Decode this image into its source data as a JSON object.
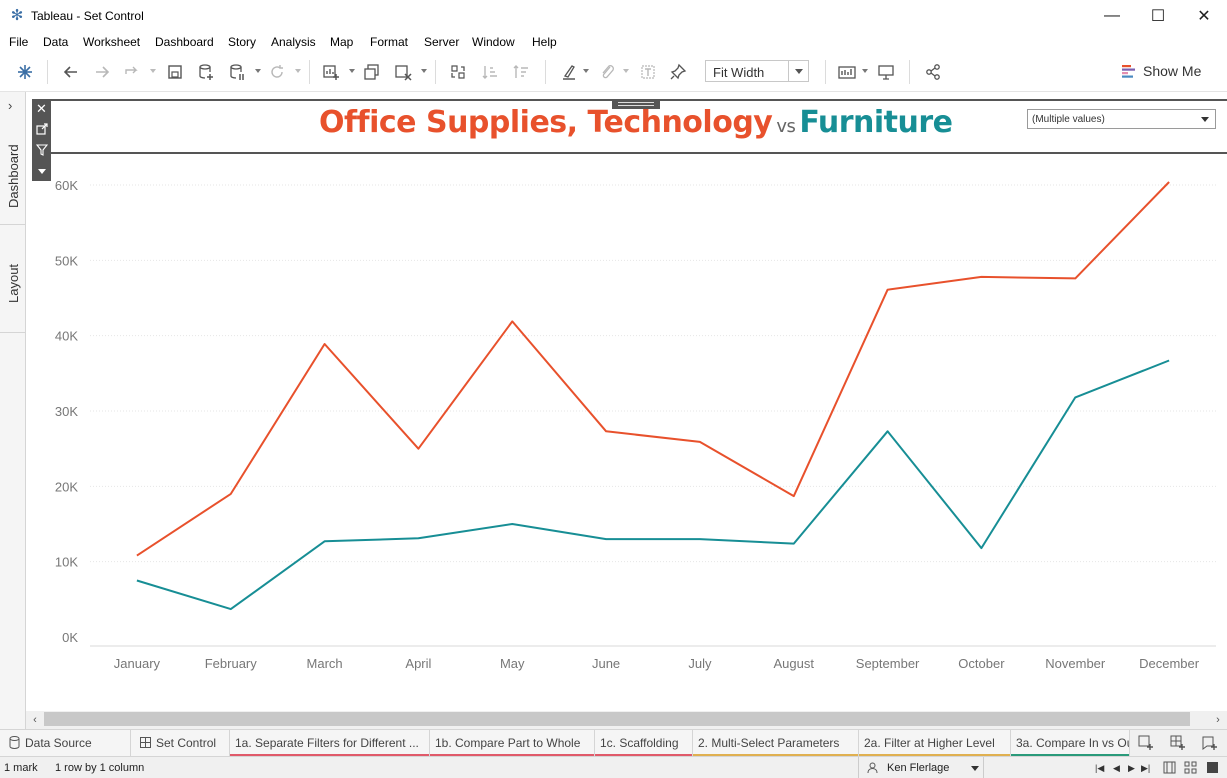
{
  "window": {
    "title": "Tableau - Set Control"
  },
  "menu": [
    "File",
    "Data",
    "Worksheet",
    "Dashboard",
    "Story",
    "Analysis",
    "Map",
    "Format",
    "Server",
    "Window",
    "Help"
  ],
  "toolbar": {
    "fit_label": "Fit Width",
    "show_me_label": "Show Me"
  },
  "sidebar": {
    "tabs": [
      "Dashboard",
      "Layout"
    ]
  },
  "dashboard": {
    "title_part1": "Office Supplies, Technology",
    "title_vs": "vs",
    "title_part2": "Furniture",
    "filter_value": "(Multiple values)"
  },
  "chart_data": {
    "type": "line",
    "categories": [
      "January",
      "February",
      "March",
      "April",
      "May",
      "June",
      "July",
      "August",
      "September",
      "October",
      "November",
      "December"
    ],
    "series": [
      {
        "name": "Office Supplies, Technology",
        "color": "#e8512c",
        "values": [
          10800,
          19000,
          38900,
          25000,
          41900,
          27300,
          25900,
          18700,
          46100,
          47800,
          47600,
          60400
        ]
      },
      {
        "name": "Furniture",
        "color": "#178e95",
        "values": [
          7500,
          3700,
          12700,
          13100,
          15000,
          13000,
          13000,
          12400,
          27300,
          11800,
          31800,
          36700
        ]
      }
    ],
    "yticks": [
      "0K",
      "10K",
      "20K",
      "30K",
      "40K",
      "50K",
      "60K"
    ],
    "ylim": [
      0,
      60000
    ],
    "grid": true
  },
  "sheet_tabs": [
    {
      "label": "Data Source",
      "color": ""
    },
    {
      "label": "Set Control",
      "color": ""
    },
    {
      "label": "1a. Separate Filters for Different ...",
      "color": "#e05a6a"
    },
    {
      "label": "1b. Compare Part to Whole",
      "color": "#e05a6a"
    },
    {
      "label": "1c. Scaffolding",
      "color": "#e05a6a"
    },
    {
      "label": "2. Multi-Select Parameters",
      "color": "#e0b050"
    },
    {
      "label": "2a. Filter at Higher Level",
      "color": "#e0b050"
    },
    {
      "label": "3a. Compare In vs Ou",
      "color": "#2a9a7a"
    }
  ],
  "status": {
    "marks": "1 mark",
    "rows": "1 row by 1 column",
    "user": "Ken Flerlage"
  }
}
